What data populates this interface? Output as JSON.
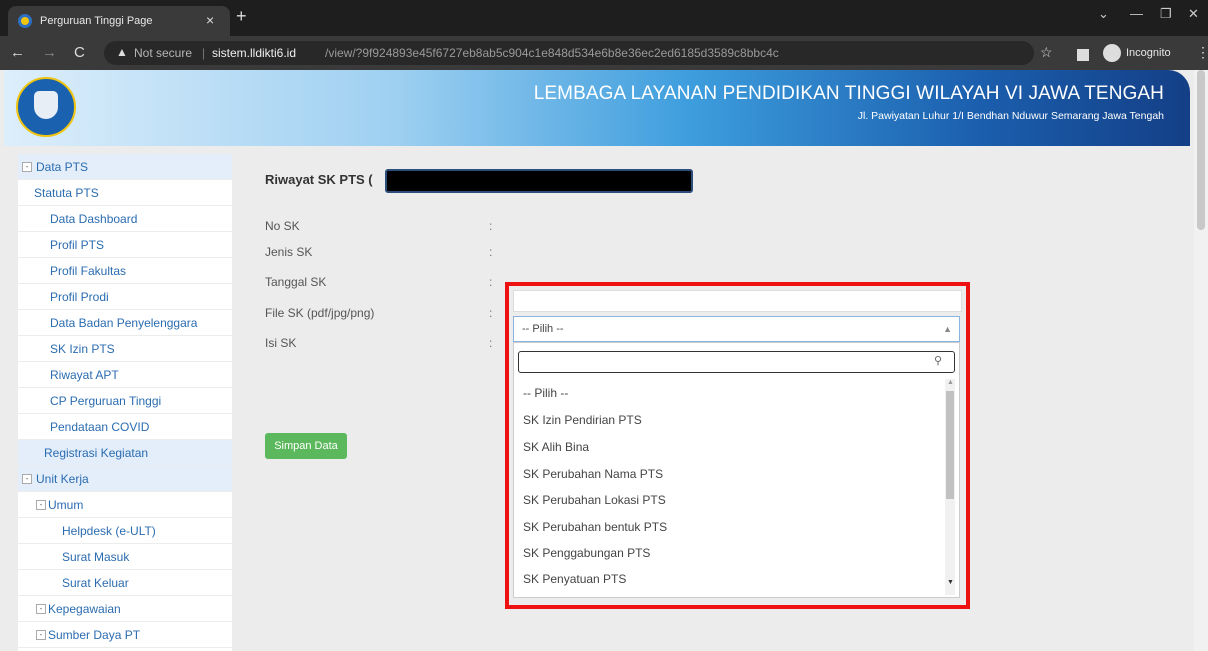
{
  "browser": {
    "tab_title": "Perguruan Tinggi Page",
    "tab_close": "×",
    "new_tab": "+",
    "not_secure": "Not secure",
    "url_host": "sistem.lldikti6.id",
    "url_path": "/view/?9f924893e45f6727eb8ab5c904c1e848d534e6b8e36ec2ed6185d3589c8bbc4c",
    "incognito_label": "Incognito",
    "icons": {
      "back": "back-arrow-icon",
      "forward": "forward-arrow-icon",
      "reload": "reload-icon",
      "warning": "warning-icon",
      "bookmark": "star-icon",
      "side_panel": "side-panel-icon",
      "incognito": "incognito-icon",
      "menu": "menu-dots-icon"
    }
  },
  "banner": {
    "title": "LEMBAGA LAYANAN PENDIDIKAN TINGGI WILAYAH VI JAWA TENGAH",
    "subtitle": "Jl. Pawiyatan Luhur 1/I Bendhan Nduwur Semarang Jawa Tengah"
  },
  "sidebar": {
    "items": [
      {
        "label": "Data PTS"
      },
      {
        "label": "Statuta PTS"
      },
      {
        "label": "Data Dashboard"
      },
      {
        "label": "Profil PTS"
      },
      {
        "label": "Profil Fakultas"
      },
      {
        "label": "Profil Prodi"
      },
      {
        "label": "Data Badan Penyelenggara"
      },
      {
        "label": "SK Izin PTS"
      },
      {
        "label": "Riwayat APT"
      },
      {
        "label": "CP Perguruan Tinggi"
      },
      {
        "label": "Pendataan COVID"
      },
      {
        "label": "Registrasi Kegiatan"
      },
      {
        "label": "Unit Kerja"
      },
      {
        "label": "Umum"
      },
      {
        "label": "Helpdesk (e-ULT)"
      },
      {
        "label": "Surat Masuk"
      },
      {
        "label": "Surat Keluar"
      },
      {
        "label": "Kepegawaian"
      },
      {
        "label": "Sumber Daya PT"
      }
    ]
  },
  "form": {
    "title": "Riwayat SK PTS (",
    "fields": [
      {
        "label": "No SK",
        "colon": ":"
      },
      {
        "label": "Jenis SK",
        "colon": ":"
      },
      {
        "label": "Tanggal SK",
        "colon": ":"
      },
      {
        "label": "File SK (pdf/jpg/png)",
        "colon": ":"
      },
      {
        "label": "Isi SK",
        "colon": ":"
      }
    ],
    "save_label": "Simpan Data",
    "jenis_selected": "-- Pilih --",
    "search_value": "",
    "options": [
      "-- Pilih --",
      "SK Izin Pendirian PTS",
      "SK Alih Bina",
      "SK Perubahan Nama PTS",
      "SK Perubahan Lokasi PTS",
      "SK Perubahan bentuk PTS",
      "SK Penggabungan PTS",
      "SK Penyatuan PTS"
    ]
  },
  "colors": {
    "accent_red": "#ee1111",
    "save_green": "#5cb85c",
    "link_blue": "#2b6cb0"
  }
}
